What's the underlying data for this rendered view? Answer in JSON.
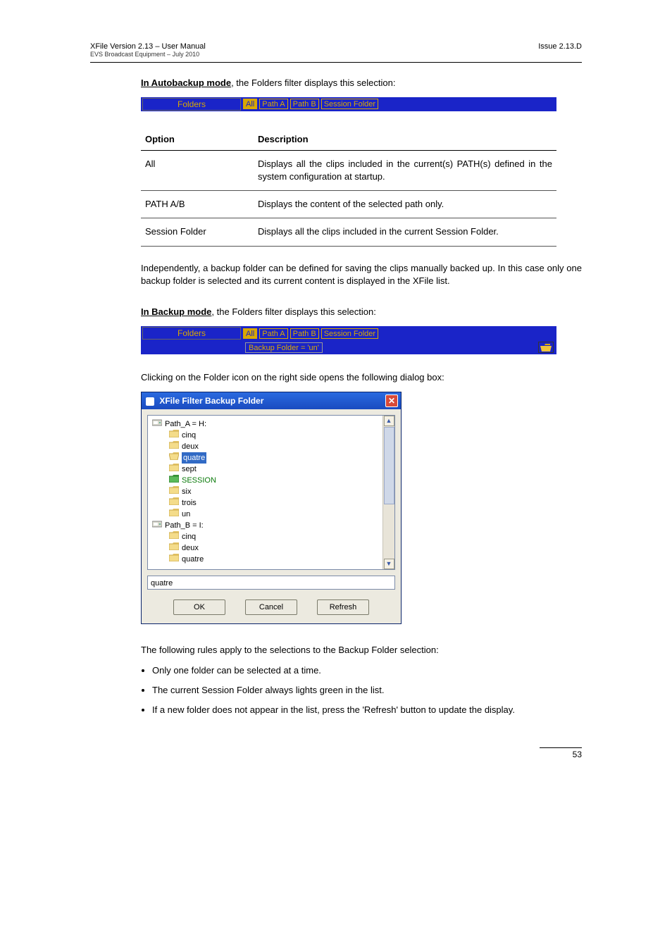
{
  "header": {
    "left_line1": "XFile Version 2.13 – User Manual",
    "left_line2": "EVS Broadcast Equipment – July 2010",
    "right_line1": "Issue 2.13.D"
  },
  "p1_prefix": "In Autobackup mode",
  "p1_rest": ", the Folders filter displays this selection:",
  "folders_bar1": {
    "label": "Folders",
    "chips": [
      "All",
      "Path A",
      "Path B",
      "Session Folder"
    ]
  },
  "table": {
    "h1": "Option",
    "h2": "Description",
    "rows": [
      {
        "opt": "All",
        "desc": "Displays all the clips included in the current(s) PATH(s) defined in the system configuration at startup."
      },
      {
        "opt": "PATH A/B",
        "desc": "Displays the content of the selected path only."
      },
      {
        "opt": "Session Folder",
        "desc": "Displays all the clips included in the current Session Folder."
      }
    ]
  },
  "p2": "Independently, a backup folder can be defined for saving the clips manually backed up. In this case only one backup folder is selected and its current content is displayed in the XFile list.",
  "p3_prefix": "In Backup mode",
  "p3_rest": ", the Folders filter displays this selection:",
  "folders_bar2": {
    "label": "Folders",
    "chips": [
      "All",
      "Path A",
      "Path B",
      "Session Folder"
    ],
    "backup_line": "Backup Folder  = 'un'"
  },
  "p4": "Clicking on the Folder icon on the right side opens the following dialog box:",
  "dialog": {
    "title": "XFile Filter Backup Folder",
    "tree": [
      {
        "level": 1,
        "type": "drive",
        "label": "Path_A = H:"
      },
      {
        "level": 2,
        "type": "folder",
        "label": "cinq"
      },
      {
        "level": 2,
        "type": "folder",
        "label": "deux"
      },
      {
        "level": 2,
        "type": "folder-open",
        "label": "quatre",
        "selected": true
      },
      {
        "level": 2,
        "type": "folder",
        "label": "sept"
      },
      {
        "level": 2,
        "type": "folder",
        "label": "SESSION",
        "green": true
      },
      {
        "level": 2,
        "type": "folder",
        "label": "six"
      },
      {
        "level": 2,
        "type": "folder",
        "label": "trois"
      },
      {
        "level": 2,
        "type": "folder",
        "label": "un"
      },
      {
        "level": 1,
        "type": "drive",
        "label": "Path_B = I:"
      },
      {
        "level": 2,
        "type": "folder",
        "label": "cinq"
      },
      {
        "level": 2,
        "type": "folder",
        "label": "deux"
      },
      {
        "level": 2,
        "type": "folder",
        "label": "quatre"
      }
    ],
    "selected_input": "quatre",
    "buttons": {
      "ok": "OK",
      "cancel": "Cancel",
      "refresh": "Refresh"
    }
  },
  "p5": "The following rules apply to the selections to the Backup Folder selection:",
  "bullets": [
    "Only one folder can be selected at a time.",
    "The current Session Folder always lights green in the list.",
    "If a new folder does not appear in the list, press the 'Refresh' button to update the display."
  ],
  "page_number": "53"
}
